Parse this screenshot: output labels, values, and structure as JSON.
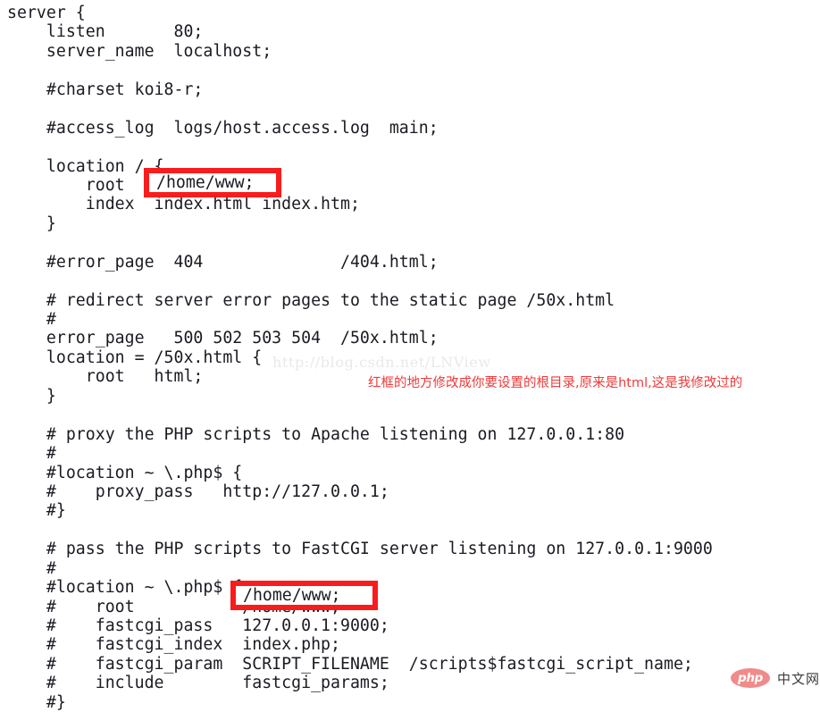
{
  "document": {
    "type": "nginx-configuration-screenshot",
    "background_color": "#ffffff",
    "code_color": "#1a1a22"
  },
  "code": {
    "language": "nginx",
    "lines": [
      "server {",
      "    listen       80;",
      "    server_name  localhost;",
      "",
      "    #charset koi8-r;",
      "",
      "    #access_log  logs/host.access.log  main;",
      "",
      "    location / {",
      "        root   /home/www;",
      "        index  index.html index.htm;",
      "    }",
      "",
      "    #error_page  404              /404.html;",
      "",
      "    # redirect server error pages to the static page /50x.html",
      "    #",
      "    error_page   500 502 503 504  /50x.html;",
      "    location = /50x.html {",
      "        root   html;",
      "    }",
      "",
      "    # proxy the PHP scripts to Apache listening on 127.0.0.1:80",
      "    #",
      "    #location ~ \\.php$ {",
      "    #    proxy_pass   http://127.0.0.1;",
      "    #}",
      "",
      "    # pass the PHP scripts to FastCGI server listening on 127.0.0.1:9000",
      "    #",
      "    #location ~ \\.php$ {",
      "    #    root           /home/www;",
      "    #    fastcgi_pass   127.0.0.1:9000;",
      "    #    fastcgi_index  index.php;",
      "    #    fastcgi_param  SCRIPT_FILENAME  /scripts$fastcgi_script_name;",
      "    #    include        fastcgi_params;",
      "    #}"
    ]
  },
  "annotations": {
    "highlight_color": "#f91c1c",
    "boxes": [
      {
        "label": "root-directive-location-block",
        "text": "/home/www;"
      },
      {
        "label": "root-directive-fastcgi-block",
        "text": "/home/www;"
      }
    ],
    "note": {
      "text": "红框的地方修改成你要设置的根目录,原来是html,这是我修改过的",
      "color": "#ef3a3a"
    }
  },
  "watermark": {
    "text": "http://blog.csdn.net/LNView",
    "color": "#e9e9e9"
  },
  "logo": {
    "badge_text": "php",
    "badge_color": "#f18a8a",
    "suffix_text": "中文网",
    "suffix_color": "#3c3c3c"
  }
}
